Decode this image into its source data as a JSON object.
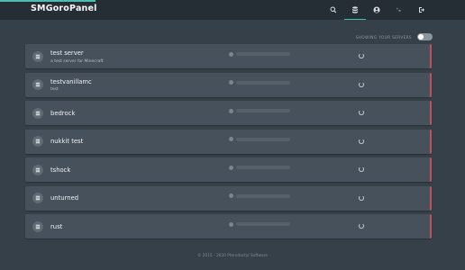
{
  "app": {
    "brand": "SMGoroPanel",
    "accent_color": "#4fbbb3"
  },
  "nav": {
    "items": [
      {
        "icon": "search-icon",
        "active": false
      },
      {
        "icon": "servers-database-icon",
        "active": true
      },
      {
        "icon": "account-icon",
        "active": false
      },
      {
        "icon": "settings-cogs-icon",
        "active": false
      },
      {
        "icon": "logout-icon",
        "active": false
      }
    ]
  },
  "filter": {
    "label": "SHOWING YOUR SERVERS",
    "toggle_on": false
  },
  "servers": [
    {
      "name": "test server",
      "description": "a test server for Minecraft",
      "status_color": "#c1505a"
    },
    {
      "name": "testvanillamc",
      "description": "test",
      "status_color": "#c1505a"
    },
    {
      "name": "bedrock",
      "description": "",
      "status_color": "#c1505a"
    },
    {
      "name": "nukkit test",
      "description": "",
      "status_color": "#c1505a"
    },
    {
      "name": "tshock",
      "description": "",
      "status_color": "#c1505a"
    },
    {
      "name": "unturned",
      "description": "",
      "status_color": "#c1505a"
    },
    {
      "name": "rust",
      "description": "",
      "status_color": "#c1505a"
    }
  ],
  "footer": {
    "text": "© 2015 - 2020 Pterodactyl Software"
  }
}
